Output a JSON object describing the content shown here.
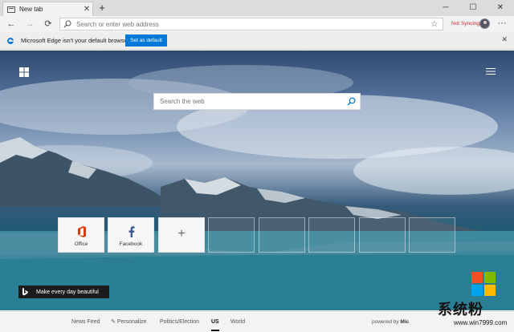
{
  "browser": {
    "tab": {
      "title": "New tab",
      "close_glyph": "✕"
    },
    "newtab_glyph": "+",
    "window_controls": [
      "─",
      "☐",
      "✕"
    ],
    "nav": {
      "back": "←",
      "forward": "→",
      "refresh": "⟳"
    },
    "address_placeholder": "Search or enter web address",
    "favorite_glyph": "☆",
    "sync_status": "Not Syncing",
    "menu_glyph": "···"
  },
  "infobar": {
    "message": "Microsoft Edge isn't your default browser",
    "button_label": "Set as default",
    "close_glyph": "✕"
  },
  "ntp": {
    "search_placeholder": "Search the web",
    "tiles": [
      {
        "label": "Office",
        "icon": "office-icon"
      },
      {
        "label": "Facebook",
        "icon": "facebook-icon"
      }
    ],
    "add_tile_glyph": "+",
    "bing_caption": "Make every day beautiful"
  },
  "bottom_nav": {
    "items": [
      "News Feed",
      "Personalize",
      "Politics/Election",
      "US",
      "World"
    ],
    "active": "US",
    "powered_prefix": "powered by",
    "powered_brand": "Mic"
  },
  "watermark": {
    "title": "系统粉",
    "url": "www.win7999.com"
  },
  "colors": {
    "accent": "#0078d7",
    "sync_red": "#c4262e",
    "office_orange": "#d83b01",
    "facebook_blue": "#3b5998"
  }
}
